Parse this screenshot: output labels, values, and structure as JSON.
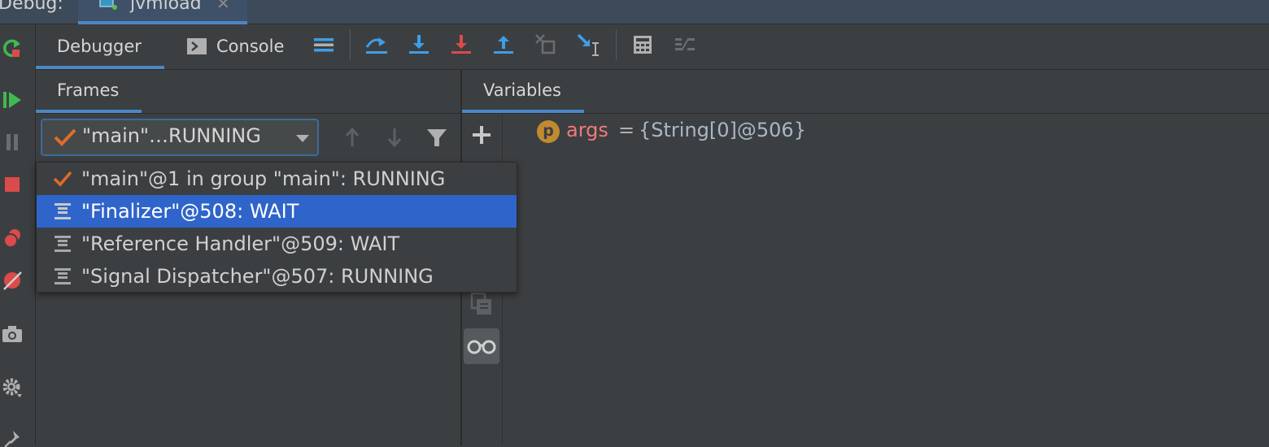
{
  "window": {
    "debug_label": "Debug:",
    "run_config_tab": "jvmload"
  },
  "tabs": {
    "debugger": "Debugger",
    "console": "Console"
  },
  "frames": {
    "header": "Frames",
    "combo_selected": "\"main\"…RUNNING"
  },
  "variables": {
    "header": "Variables",
    "items": [
      {
        "badge": "p",
        "name": "args",
        "equals": "=",
        "value": "{String[0]@506}"
      }
    ]
  },
  "thread_list": [
    {
      "label": "\"main\"@1 in group \"main\": RUNNING",
      "icon": "check-icon",
      "selected": false
    },
    {
      "label": "\"Finalizer\"@508: WAIT",
      "icon": "thread-icon",
      "selected": true
    },
    {
      "label": "\"Reference Handler\"@509: WAIT",
      "icon": "thread-icon",
      "selected": false
    },
    {
      "label": "\"Signal Dispatcher\"@507: RUNNING",
      "icon": "thread-icon",
      "selected": false
    }
  ],
  "colors": {
    "accent": "#4a88c7",
    "selection": "#2f65ca",
    "check": "#e06c2b",
    "resume_green": "#3fb950",
    "stop_red": "#db4b4b",
    "step_blue": "#3d9ee8"
  }
}
